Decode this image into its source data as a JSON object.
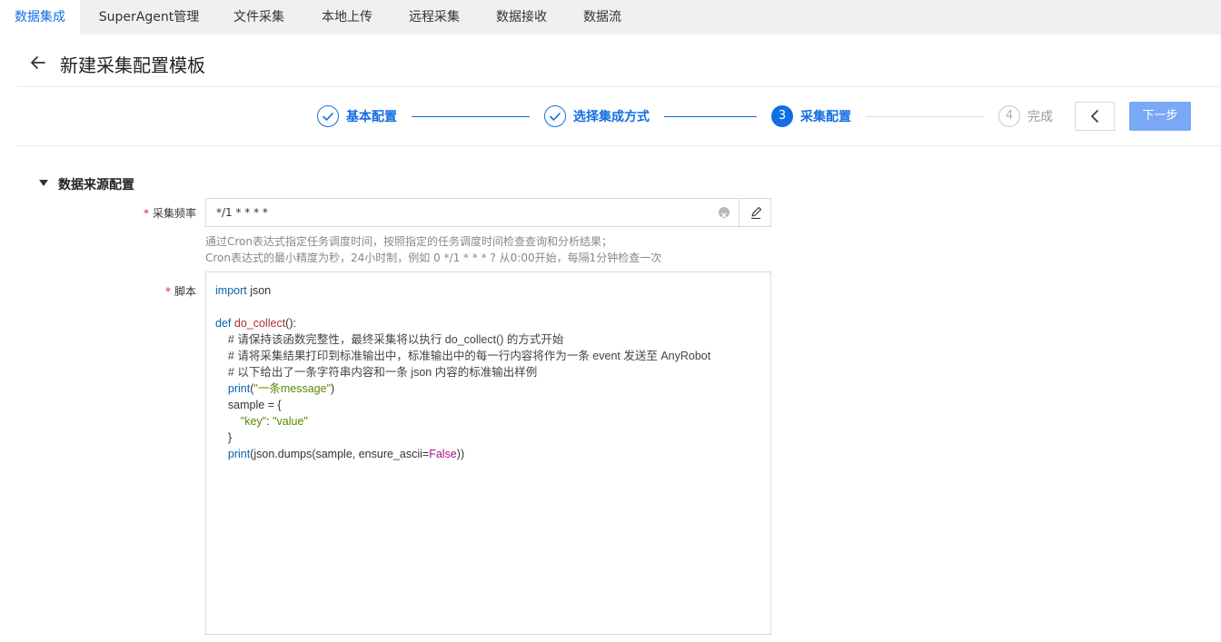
{
  "top_tabs": [
    "数据集成",
    "SuperAgent管理",
    "文件采集",
    "本地上传",
    "远程采集",
    "数据接收",
    "数据流"
  ],
  "header": {
    "title": "新建采集配置模板"
  },
  "steps": [
    {
      "label": "基本配置",
      "state": "done"
    },
    {
      "label": "选择集成方式",
      "state": "done"
    },
    {
      "number": "3",
      "label": "采集配置",
      "state": "current"
    },
    {
      "number": "4",
      "label": "完成",
      "state": "todo"
    }
  ],
  "buttons": {
    "next": "下一步"
  },
  "section": {
    "title": "数据来源配置"
  },
  "form": {
    "frequency": {
      "required_mark": "*",
      "label": "采集频率",
      "value": "*/1 * * * *",
      "hint_line1": "通过Cron表达式指定任务调度时间，按照指定的任务调度时间检查查询和分析结果；",
      "hint_line2": "Cron表达式的最小精度为秒，24小时制，例如 0 */1 * * * ? 从0:00开始，每隔1分钟检查一次"
    },
    "script": {
      "required_mark": "*",
      "label": "脚本",
      "lines": [
        "import json",
        "",
        "def do_collect():",
        "    # 请保持该函数完整性，最终采集将以执行 do_collect() 的方式开始",
        "    # 请将采集结果打印到标准输出中，标准输出中的每一行内容将作为一条 event 发送至 AnyRobot",
        "    # 以下给出了一条字符串内容和一条 json 内容的标准输出样例",
        "    print(\"一条message\")",
        "    sample = {",
        "        \"key\": \"value\"",
        "    }",
        "    print(json.dumps(sample, ensure_ascii=False))"
      ]
    }
  },
  "colors": {
    "accent": "#126ee3",
    "required": "#e02020",
    "next_button": "#7aa8f5"
  },
  "icons": {
    "back": "arrow-left-icon",
    "check": "check-icon",
    "prev": "chevron-left-icon",
    "clear": "close-circle-icon",
    "edit": "pencil-icon",
    "caret": "caret-down-icon"
  }
}
